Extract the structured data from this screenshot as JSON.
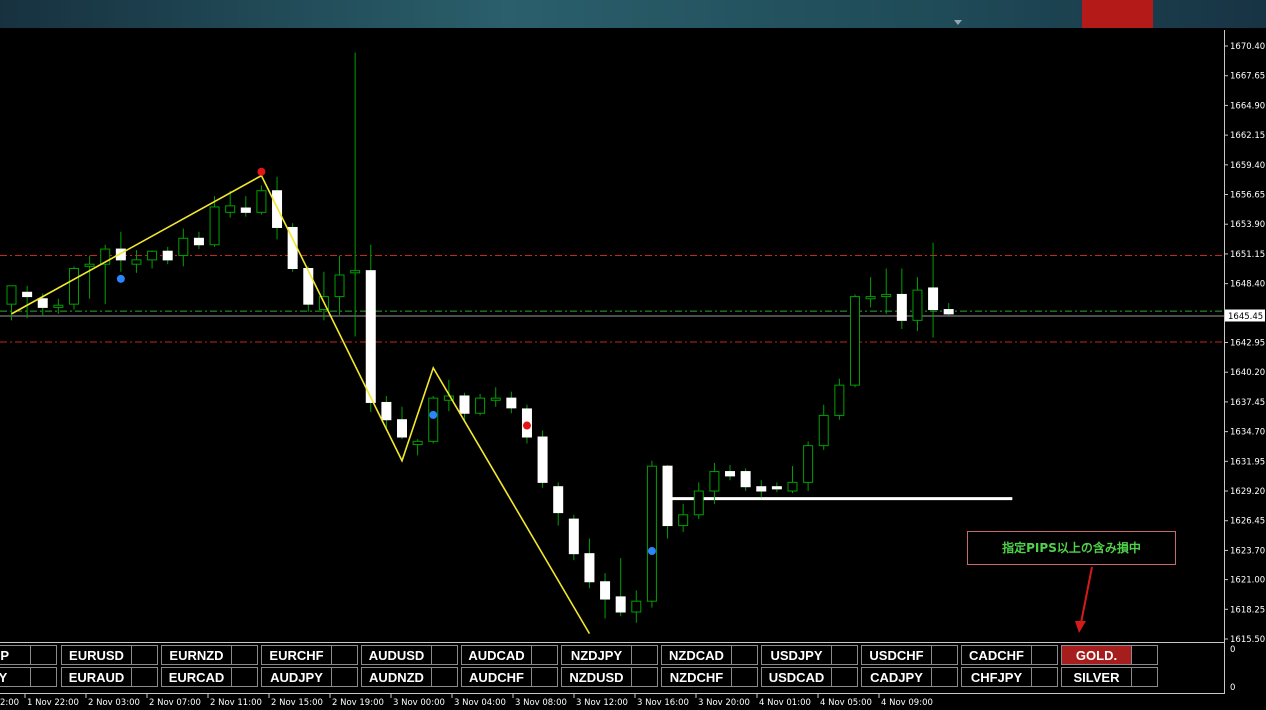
{
  "window": {
    "colors": {
      "background": "#000000",
      "bull_candle": "#ffffff",
      "bear_candle": "#ffffff",
      "wick": "#00a000",
      "zigzag": "#f2e82b",
      "resistance": "#c0281e",
      "current_level": "#2ea82e",
      "low_dot": "#2a86ff",
      "high_dot": "#e01515",
      "active_button": "#a51d1d"
    }
  },
  "chart_data": {
    "type": "candlestick",
    "title": "",
    "symbol": "GOLD.",
    "y_ticks": [
      "1670.40",
      "1667.65",
      "1664.90",
      "1662.15",
      "1659.40",
      "1656.65",
      "1653.90",
      "1651.15",
      "1648.40",
      "1645.45",
      "1642.95",
      "1640.20",
      "1637.45",
      "1634.70",
      "1631.95",
      "1629.20",
      "1626.45",
      "1623.70",
      "1621.00",
      "1618.25",
      "1615.50"
    ],
    "y_tick_values": [
      1670.4,
      1667.65,
      1664.9,
      1662.15,
      1659.4,
      1656.65,
      1653.9,
      1651.15,
      1648.4,
      1645.45,
      1642.95,
      1640.2,
      1637.45,
      1634.7,
      1631.95,
      1629.2,
      1626.45,
      1623.7,
      1621.0,
      1618.25,
      1615.5
    ],
    "current_price": "1645.45",
    "ylim": [
      1615.3,
      1672.1
    ],
    "x_labels": [
      "1 Nov 22:00",
      "2 Nov 03:00",
      "2 Nov 07:00",
      "2 Nov 11:00",
      "2 Nov 15:00",
      "2 Nov 19:00",
      "3 Nov 00:00",
      "3 Nov 04:00",
      "3 Nov 08:00",
      "3 Nov 12:00",
      "3 Nov 16:00",
      "3 Nov 20:00",
      "4 Nov 01:00",
      "4 Nov 05:00",
      "4 Nov 09:00"
    ],
    "x_label_fragment": "2:00",
    "candles": [
      {
        "o": 1646.5,
        "h": 1648.2,
        "l": 1645.0,
        "c": 1648.2
      },
      {
        "o": 1647.6,
        "h": 1648.2,
        "l": 1645.2,
        "c": 1647.2
      },
      {
        "o": 1647.0,
        "h": 1647.5,
        "l": 1645.4,
        "c": 1646.2
      },
      {
        "o": 1646.2,
        "h": 1647.0,
        "l": 1645.6,
        "c": 1646.4
      },
      {
        "o": 1646.5,
        "h": 1650.0,
        "l": 1646.0,
        "c": 1649.8
      },
      {
        "o": 1650.0,
        "h": 1651.0,
        "l": 1647.0,
        "c": 1650.2
      },
      {
        "o": 1650.2,
        "h": 1652.0,
        "l": 1646.5,
        "c": 1651.6
      },
      {
        "o": 1651.6,
        "h": 1653.2,
        "l": 1649.5,
        "c": 1650.6
      },
      {
        "o": 1650.2,
        "h": 1651.5,
        "l": 1649.4,
        "c": 1650.6
      },
      {
        "o": 1650.6,
        "h": 1651.5,
        "l": 1649.8,
        "c": 1651.4
      },
      {
        "o": 1651.4,
        "h": 1651.8,
        "l": 1650.2,
        "c": 1650.6
      },
      {
        "o": 1651.0,
        "h": 1653.5,
        "l": 1650.0,
        "c": 1652.6
      },
      {
        "o": 1652.6,
        "h": 1653.2,
        "l": 1651.6,
        "c": 1652.0
      },
      {
        "o": 1652.0,
        "h": 1656.5,
        "l": 1651.8,
        "c": 1655.5
      },
      {
        "o": 1655.0,
        "h": 1657.0,
        "l": 1654.5,
        "c": 1655.6
      },
      {
        "o": 1655.4,
        "h": 1656.5,
        "l": 1654.6,
        "c": 1655.0
      },
      {
        "o": 1655.0,
        "h": 1657.5,
        "l": 1654.8,
        "c": 1657.0
      },
      {
        "o": 1657.0,
        "h": 1658.3,
        "l": 1652.5,
        "c": 1653.6
      },
      {
        "o": 1653.6,
        "h": 1654.0,
        "l": 1649.5,
        "c": 1649.8
      },
      {
        "o": 1649.8,
        "h": 1650.0,
        "l": 1645.8,
        "c": 1646.5
      },
      {
        "o": 1646.0,
        "h": 1649.5,
        "l": 1645.0,
        "c": 1647.2
      },
      {
        "o": 1647.2,
        "h": 1651.0,
        "l": 1645.5,
        "c": 1649.2
      },
      {
        "o": 1649.4,
        "h": 1669.8,
        "l": 1643.5,
        "c": 1649.6
      },
      {
        "o": 1649.6,
        "h": 1652.0,
        "l": 1636.5,
        "c": 1637.4
      },
      {
        "o": 1637.4,
        "h": 1638.0,
        "l": 1634.8,
        "c": 1635.8
      },
      {
        "o": 1635.8,
        "h": 1637.0,
        "l": 1634.0,
        "c": 1634.2
      },
      {
        "o": 1633.5,
        "h": 1634.0,
        "l": 1632.5,
        "c": 1633.8
      },
      {
        "o": 1633.8,
        "h": 1638.0,
        "l": 1633.6,
        "c": 1637.8
      },
      {
        "o": 1637.6,
        "h": 1639.5,
        "l": 1636.6,
        "c": 1638.0
      },
      {
        "o": 1638.0,
        "h": 1638.3,
        "l": 1635.6,
        "c": 1636.4
      },
      {
        "o": 1636.4,
        "h": 1638.2,
        "l": 1636.2,
        "c": 1637.8
      },
      {
        "o": 1637.6,
        "h": 1638.8,
        "l": 1637.0,
        "c": 1637.8
      },
      {
        "o": 1637.8,
        "h": 1638.4,
        "l": 1636.4,
        "c": 1636.9
      },
      {
        "o": 1636.8,
        "h": 1637.2,
        "l": 1633.6,
        "c": 1634.2
      },
      {
        "o": 1634.2,
        "h": 1634.8,
        "l": 1629.5,
        "c": 1630.0
      },
      {
        "o": 1629.6,
        "h": 1630.0,
        "l": 1626.0,
        "c": 1627.2
      },
      {
        "o": 1626.6,
        "h": 1627.0,
        "l": 1622.8,
        "c": 1623.4
      },
      {
        "o": 1623.4,
        "h": 1624.8,
        "l": 1620.2,
        "c": 1620.8
      },
      {
        "o": 1620.8,
        "h": 1621.6,
        "l": 1617.4,
        "c": 1619.2
      },
      {
        "o": 1619.4,
        "h": 1623.0,
        "l": 1617.6,
        "c": 1618.0
      },
      {
        "o": 1618.0,
        "h": 1620.0,
        "l": 1617.0,
        "c": 1619.0
      },
      {
        "o": 1619.0,
        "h": 1632.0,
        "l": 1618.4,
        "c": 1631.5
      },
      {
        "o": 1631.5,
        "h": 1631.6,
        "l": 1624.8,
        "c": 1626.0
      },
      {
        "o": 1626.0,
        "h": 1628.0,
        "l": 1625.4,
        "c": 1627.0
      },
      {
        "o": 1627.0,
        "h": 1630.0,
        "l": 1626.6,
        "c": 1629.2
      },
      {
        "o": 1629.2,
        "h": 1631.8,
        "l": 1628.0,
        "c": 1631.0
      },
      {
        "o": 1631.0,
        "h": 1631.6,
        "l": 1630.2,
        "c": 1630.6
      },
      {
        "o": 1631.0,
        "h": 1631.3,
        "l": 1629.2,
        "c": 1629.6
      },
      {
        "o": 1629.6,
        "h": 1630.2,
        "l": 1628.6,
        "c": 1629.2
      },
      {
        "o": 1629.6,
        "h": 1630.0,
        "l": 1629.1,
        "c": 1629.4
      },
      {
        "o": 1629.2,
        "h": 1631.5,
        "l": 1629.0,
        "c": 1630.0
      },
      {
        "o": 1630.0,
        "h": 1633.8,
        "l": 1629.2,
        "c": 1633.4
      },
      {
        "o": 1633.4,
        "h": 1637.2,
        "l": 1633.0,
        "c": 1636.2
      },
      {
        "o": 1636.2,
        "h": 1639.6,
        "l": 1635.8,
        "c": 1639.0
      },
      {
        "o": 1639.0,
        "h": 1647.4,
        "l": 1638.8,
        "c": 1647.2
      },
      {
        "o": 1647.0,
        "h": 1649.0,
        "l": 1646.2,
        "c": 1647.2
      },
      {
        "o": 1647.2,
        "h": 1649.8,
        "l": 1645.6,
        "c": 1647.4
      },
      {
        "o": 1647.4,
        "h": 1649.8,
        "l": 1644.2,
        "c": 1645.0
      },
      {
        "o": 1645.0,
        "h": 1649.0,
        "l": 1644.0,
        "c": 1647.8
      },
      {
        "o": 1648.0,
        "h": 1652.2,
        "l": 1643.4,
        "c": 1646.0
      },
      {
        "o": 1646.0,
        "h": 1646.6,
        "l": 1645.4,
        "c": 1645.6
      }
    ],
    "zigzag": [
      {
        "i": 0,
        "v": 1645.6
      },
      {
        "i": 16,
        "v": 1658.4
      },
      {
        "i": 25,
        "v": 1632.0
      },
      {
        "i": 27,
        "v": 1640.6
      },
      {
        "i": 37,
        "v": 1616.0
      }
    ],
    "high_markers": [
      {
        "i": 16,
        "v": 1658.3
      },
      {
        "i": 33,
        "v": 1634.8
      }
    ],
    "low_markers": [
      {
        "i": 7,
        "v": 1649.4
      },
      {
        "i": 27,
        "v": 1636.8
      },
      {
        "i": 41,
        "v": 1624.2
      }
    ],
    "lines": {
      "resistance_upper": 1651.0,
      "resistance_lower": 1643.0,
      "current": 1645.85,
      "support": {
        "value": 1628.5,
        "from_i": 42,
        "to_i": 61
      }
    },
    "sub_window": {
      "y_ticks": [
        "0",
        "0"
      ]
    }
  },
  "panel": {
    "row1": [
      "GBP",
      "EURUSD",
      "EURNZD",
      "EURCHF",
      "AUDUSD",
      "AUDCAD",
      "NZDJPY",
      "NZDCAD",
      "USDJPY",
      "USDCHF",
      "CADCHF",
      "GOLD."
    ],
    "row2": [
      "JPY",
      "EURAUD",
      "EURCAD",
      "AUDJPY",
      "AUDNZD",
      "AUDCHF",
      "NZDUSD",
      "NZDCHF",
      "USDCAD",
      "CADJPY",
      "CHFJPY",
      "SILVER"
    ],
    "active": "GOLD."
  },
  "alert": {
    "text": "指定PIPS以上の含み損中"
  }
}
